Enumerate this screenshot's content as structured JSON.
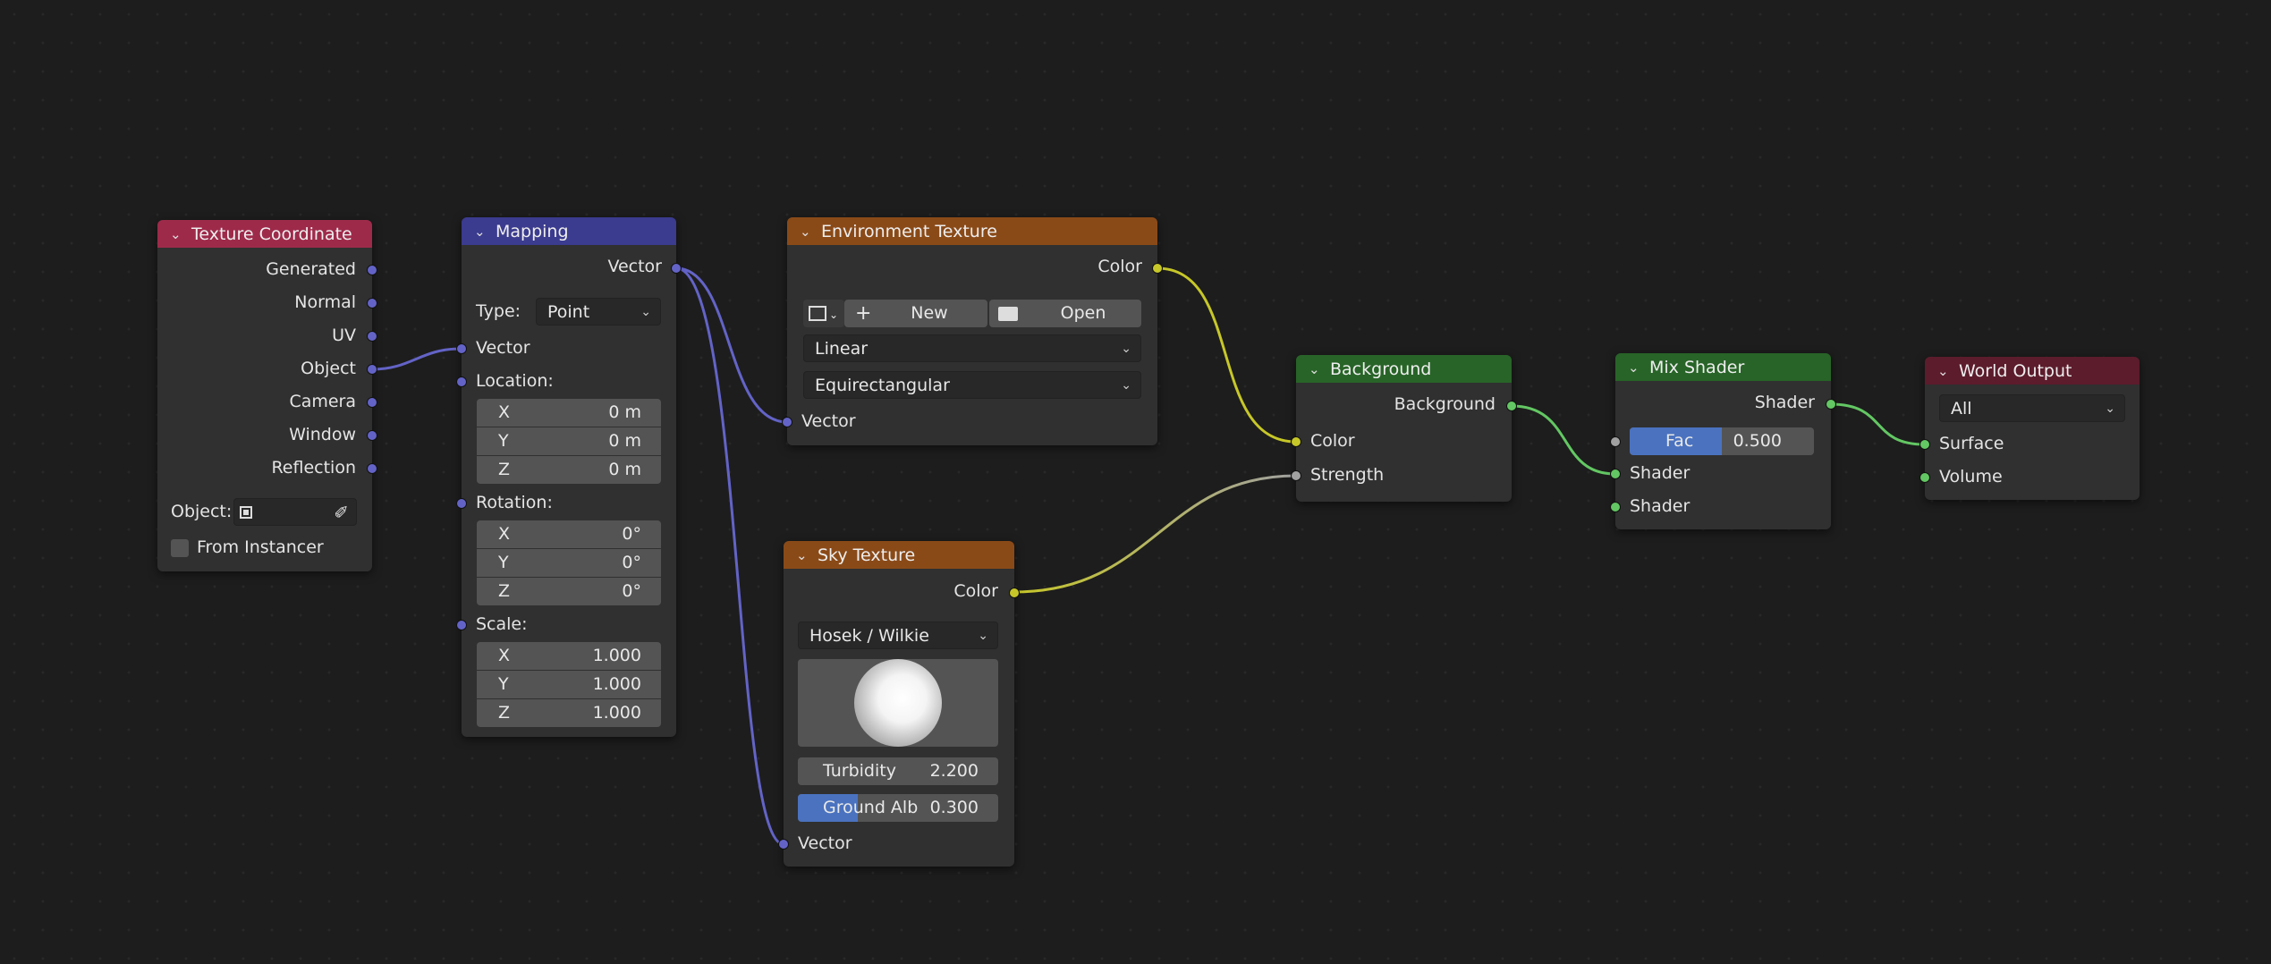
{
  "nodes": {
    "texcoord": {
      "title": "Texture Coordinate",
      "outputs": [
        "Generated",
        "Normal",
        "UV",
        "Object",
        "Camera",
        "Window",
        "Reflection"
      ],
      "object_label": "Object:",
      "from_instancer": "From Instancer"
    },
    "mapping": {
      "title": "Mapping",
      "output": "Vector",
      "type_label": "Type:",
      "type_value": "Point",
      "input_vector": "Vector",
      "location_label": "Location:",
      "location": [
        {
          "axis": "X",
          "value": "0 m"
        },
        {
          "axis": "Y",
          "value": "0 m"
        },
        {
          "axis": "Z",
          "value": "0 m"
        }
      ],
      "rotation_label": "Rotation:",
      "rotation": [
        {
          "axis": "X",
          "value": "0°"
        },
        {
          "axis": "Y",
          "value": "0°"
        },
        {
          "axis": "Z",
          "value": "0°"
        }
      ],
      "scale_label": "Scale:",
      "scale": [
        {
          "axis": "X",
          "value": "1.000"
        },
        {
          "axis": "Y",
          "value": "1.000"
        },
        {
          "axis": "Z",
          "value": "1.000"
        }
      ]
    },
    "envtex": {
      "title": "Environment Texture",
      "output": "Color",
      "new_label": "New",
      "open_label": "Open",
      "interpolation": "Linear",
      "projection": "Equirectangular",
      "input_vector": "Vector"
    },
    "skytex": {
      "title": "Sky Texture",
      "output": "Color",
      "model": "Hosek / Wilkie",
      "turbidity_label": "Turbidity",
      "turbidity_value": "2.200",
      "ground_label": "Ground Alb",
      "ground_value": "0.300",
      "ground_fraction": 0.3,
      "input_vector": "Vector"
    },
    "background": {
      "title": "Background",
      "output": "Background",
      "input_color": "Color",
      "input_strength": "Strength"
    },
    "mixshader": {
      "title": "Mix Shader",
      "output": "Shader",
      "fac_label": "Fac",
      "fac_value": "0.500",
      "fac_fraction": 0.5,
      "input_shader1": "Shader",
      "input_shader2": "Shader"
    },
    "worldoutput": {
      "title": "World Output",
      "target": "All",
      "input_surface": "Surface",
      "input_volume": "Volume"
    }
  },
  "colors": {
    "canvas": "#1d1d1d",
    "node_body": "#303030",
    "header_texcoord": "#9e2a4a",
    "header_mapping": "#3b3b8f",
    "header_texture": "#8a4a18",
    "header_shader": "#286428",
    "header_output": "#5c1c2c",
    "socket_vector": "#6363c7",
    "socket_color": "#c7c729",
    "socket_float": "#a1a1a1",
    "socket_shader": "#63c763",
    "slider_fill": "#4a72bf"
  },
  "icons": [
    "chevron-down-icon",
    "image-icon",
    "plus-icon",
    "folder-icon",
    "eyedropper-icon",
    "object-icon"
  ]
}
